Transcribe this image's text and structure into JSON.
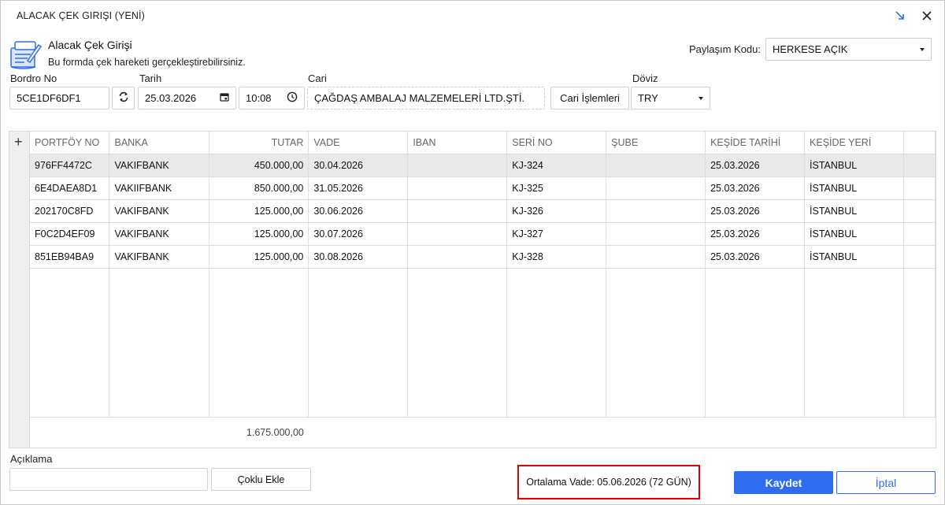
{
  "window": {
    "title": "ALACAK ÇEK GIRIŞI (YENİ)"
  },
  "header": {
    "title": "Alacak Çek Girişi",
    "subtitle": "Bu formda çek hareketi gerçekleştirebilirsiniz."
  },
  "share": {
    "label": "Paylaşım Kodu:",
    "value": "HERKESE AÇIK"
  },
  "form": {
    "bordro_label": "Bordro No",
    "bordro_value": "5CE1DF6DF1",
    "tarih_label": "Tarih",
    "tarih_value": "25.03.2026",
    "saat_value": "10:08",
    "cari_label": "Cari",
    "cari_value": "ÇAĞDAŞ AMBALAJ MALZEMELERİ LTD.ŞTİ.",
    "cari_islemleri_label": "Cari İşlemleri",
    "doviz_label": "Döviz",
    "doviz_value": "TRY"
  },
  "grid": {
    "add_symbol": "+",
    "columns": [
      "PORTFÖY NO",
      "BANKA",
      "TUTAR",
      "VADE",
      "IBAN",
      "SERİ NO",
      "ŞUBE",
      "KEŞİDE TARİHİ",
      "KEŞİDE YERİ"
    ],
    "rows": [
      {
        "portfoy": "976FF4472C",
        "banka": "VAKIFBANK",
        "tutar": "450.000,00",
        "vade": "30.04.2026",
        "iban": "",
        "seri": "KJ-324",
        "sube": "",
        "kesidetarih": "25.03.2026",
        "kesideyer": "İSTANBUL"
      },
      {
        "portfoy": "6E4DAEA8D1",
        "banka": "VAKIIFBANK",
        "tutar": "850.000,00",
        "vade": "31.05.2026",
        "iban": "",
        "seri": "KJ-325",
        "sube": "",
        "kesidetarih": "25.03.2026",
        "kesideyer": "İSTANBUL"
      },
      {
        "portfoy": "202170C8FD",
        "banka": "VAKIFBANK",
        "tutar": "125.000,00",
        "vade": "30.06.2026",
        "iban": "",
        "seri": "KJ-326",
        "sube": "",
        "kesidetarih": "25.03.2026",
        "kesideyer": "İSTANBUL"
      },
      {
        "portfoy": "F0C2D4EF09",
        "banka": "VAKIFBANK",
        "tutar": "125.000,00",
        "vade": "30.07.2026",
        "iban": "",
        "seri": "KJ-327",
        "sube": "",
        "kesidetarih": "25.03.2026",
        "kesideyer": "İSTANBUL"
      },
      {
        "portfoy": "851EB94BA9",
        "banka": "VAKIFBANK",
        "tutar": "125.000,00",
        "vade": "30.08.2026",
        "iban": "",
        "seri": "KJ-328",
        "sube": "",
        "kesidetarih": "25.03.2026",
        "kesideyer": "İSTANBUL"
      }
    ],
    "total": "1.675.000,00"
  },
  "footer": {
    "aciklama_label": "Açıklama",
    "aciklama_value": "",
    "coklu_ekle_label": "Çoklu Ekle",
    "ortalama_vade": "Ortalama Vade: 05.06.2026 (72 GÜN)",
    "save_label": "Kaydet",
    "cancel_label": "İptal"
  },
  "colors": {
    "accent": "#2e6cf0",
    "highlight": "#e00000",
    "selected_row": "#e9e9e9"
  },
  "icons": [
    "form-document-icon",
    "expand-arrow-icon",
    "close-icon",
    "refresh-icon",
    "calendar-icon",
    "clock-icon",
    "chevron-down-icon",
    "plus-icon"
  ]
}
